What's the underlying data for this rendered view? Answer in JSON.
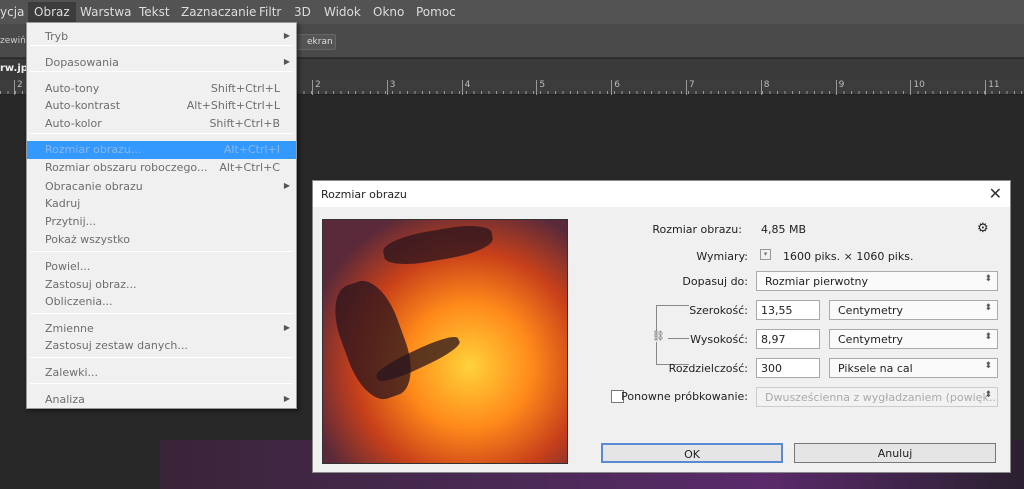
{
  "menubar": {
    "items": [
      "ycja",
      "Obraz",
      "Warstwa",
      "Tekst",
      "Zaznaczanie",
      "Filtr",
      "3D",
      "Widok",
      "Okno",
      "Pomoc"
    ]
  },
  "optbar": {
    "left_label": "zewiń",
    "button": "ekran"
  },
  "document_tab": "rw.jp",
  "ruler": {
    "left_tick": "2",
    "ticks": [
      "2",
      "3",
      "4",
      "5",
      "6",
      "7",
      "8",
      "9",
      "10",
      "11"
    ]
  },
  "menu": {
    "items": [
      {
        "label": "Tryb",
        "shortcut": "",
        "submenu": true
      },
      {
        "label": "Dopasowania",
        "shortcut": "",
        "submenu": true
      },
      {
        "label": "Auto-tony",
        "shortcut": "Shift+Ctrl+L"
      },
      {
        "label": "Auto-kontrast",
        "shortcut": "Alt+Shift+Ctrl+L"
      },
      {
        "label": "Auto-kolor",
        "shortcut": "Shift+Ctrl+B"
      },
      {
        "label": "Rozmiar obrazu...",
        "shortcut": "Alt+Ctrl+I",
        "highlighted": true
      },
      {
        "label": "Rozmiar obszaru roboczego...",
        "shortcut": "Alt+Ctrl+C"
      },
      {
        "label": "Obracanie obrazu",
        "shortcut": "",
        "submenu": true
      },
      {
        "label": "Kadruj",
        "shortcut": ""
      },
      {
        "label": "Przytnij...",
        "shortcut": ""
      },
      {
        "label": "Pokaż wszystko",
        "shortcut": ""
      },
      {
        "label": "Powiel...",
        "shortcut": ""
      },
      {
        "label": "Zastosuj obraz...",
        "shortcut": ""
      },
      {
        "label": "Obliczenia...",
        "shortcut": ""
      },
      {
        "label": "Zmienne",
        "shortcut": "",
        "submenu": true
      },
      {
        "label": "Zastosuj zestaw danych...",
        "shortcut": ""
      },
      {
        "label": "Zalewki...",
        "shortcut": ""
      },
      {
        "label": "Analiza",
        "shortcut": "",
        "submenu": true
      }
    ]
  },
  "dialog": {
    "title": "Rozmiar obrazu",
    "size_label": "Rozmiar obrazu:",
    "size_value": "4,85 MB",
    "dims_label": "Wymiary:",
    "dims_value": "1600 piks. × 1060 piks.",
    "fit_label": "Dopasuj do:",
    "fit_value": "Rozmiar pierwotny",
    "width_label": "Szerokość:",
    "width_value": "13,55",
    "width_unit": "Centymetry",
    "height_label": "Wysokość:",
    "height_value": "8,97",
    "height_unit": "Centymetry",
    "res_label": "Rozdzielczość:",
    "res_value": "300",
    "res_unit": "Piksele na cal",
    "resample_label": "Ponowne próbkowanie:",
    "resample_checked": false,
    "resample_value": "Dwusześcienna z wygładzaniem (powięk...",
    "ok": "OK",
    "cancel": "Anuluj"
  },
  "colors": {
    "highlight": "#3399ff",
    "menubar": "#535353",
    "workspace": "#282828"
  }
}
